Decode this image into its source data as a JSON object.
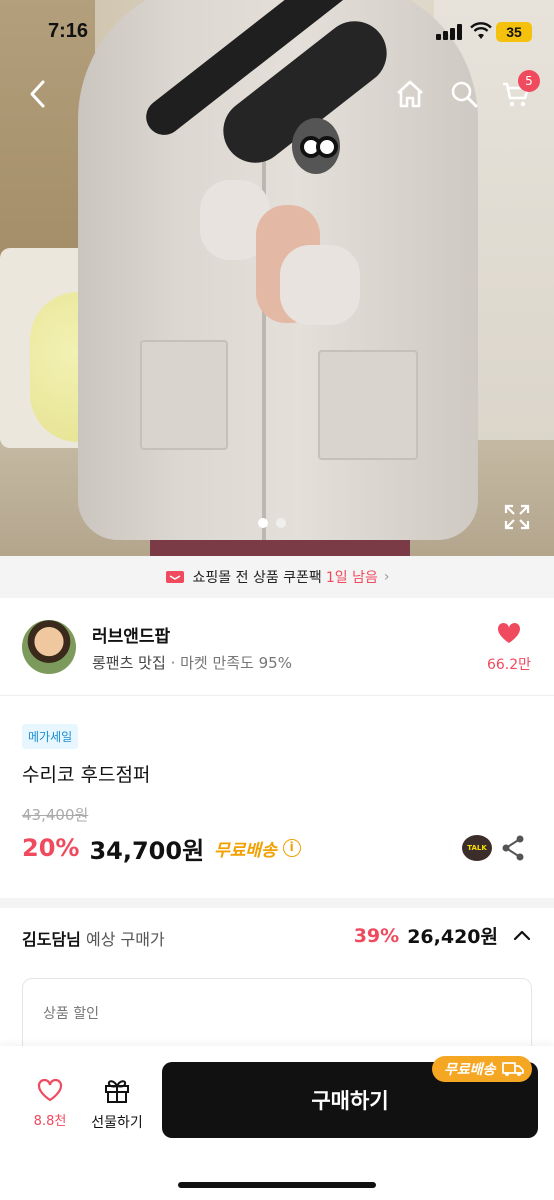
{
  "status_bar": {
    "time": "7:16",
    "battery": "35"
  },
  "header": {
    "cart_count": "5"
  },
  "coupon_banner": {
    "text": "쇼핑몰 전 상품 쿠폰팩",
    "highlight": "1일 남음"
  },
  "shop": {
    "name": "러브앤드팝",
    "tagline": "롱팬츠 맛집",
    "satisfaction": "· 마켓 만족도 95%",
    "likes": "66.2만"
  },
  "product": {
    "badge": "메가세일",
    "name": "수리코 후드점퍼",
    "original_price": "43,400원",
    "discount": "20%",
    "price": "34,700원",
    "shipping": "무료배송",
    "talk_label": "TALK"
  },
  "expected": {
    "user": "김도담님",
    "label": "예상 구매가",
    "discount": "39%",
    "price": "26,420원"
  },
  "discount_box": {
    "label": "상품 할인"
  },
  "bottom_bar": {
    "wish_count": "8.8천",
    "gift_label": "선물하기",
    "buy_label": "구매하기",
    "shipping_pill": "무료배송"
  },
  "colors": {
    "accent": "#f04a5e",
    "shipping": "#f2a000",
    "buy_button": "#111111"
  },
  "carousel": {
    "total": 2,
    "active": 1
  }
}
